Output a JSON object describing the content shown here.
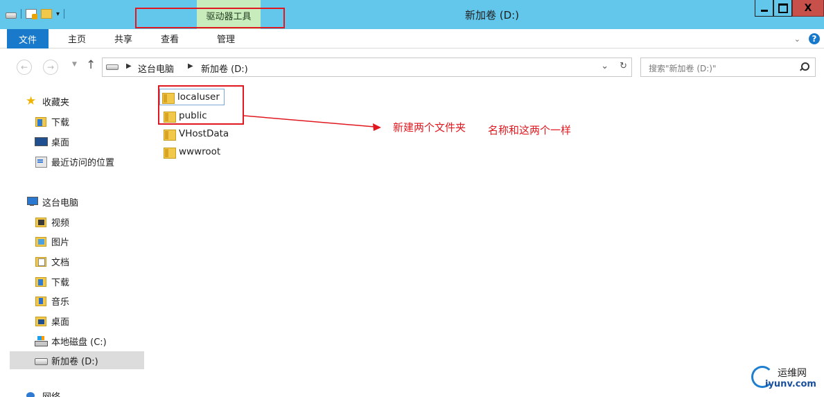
{
  "titlebar": {
    "context_tab": "驱动器工具",
    "window_title": "新加卷 (D:)",
    "close_glyph": "X"
  },
  "ribbon": {
    "tabs": [
      "文件",
      "主页",
      "共享",
      "查看",
      "管理"
    ],
    "help_glyph": "?"
  },
  "address": {
    "crumbs": [
      "这台电脑",
      "新加卷 (D:)"
    ],
    "search_placeholder": "搜索\"新加卷 (D:)\""
  },
  "sidebar": {
    "favorites": [
      "收藏夹",
      "下载",
      "桌面",
      "最近访问的位置"
    ],
    "this_pc": "这台电脑",
    "pc_items": [
      "视频",
      "图片",
      "文档",
      "下载",
      "音乐",
      "桌面",
      "本地磁盘 (C:)",
      "新加卷 (D:)"
    ],
    "network": "网络"
  },
  "files": [
    "localuser",
    "public",
    "VHostData",
    "wwwroot"
  ],
  "annotation": {
    "text1": "新建两个文件夹",
    "text2": "名称和这两个一样"
  },
  "watermark": {
    "top": "运维网",
    "bottom": "iyunv.com"
  },
  "colors": {
    "titlebar": "#63c7ec",
    "context_tab": "#c9ecbd",
    "file_tab": "#1979ca",
    "annotation_red": "#e0171e"
  }
}
